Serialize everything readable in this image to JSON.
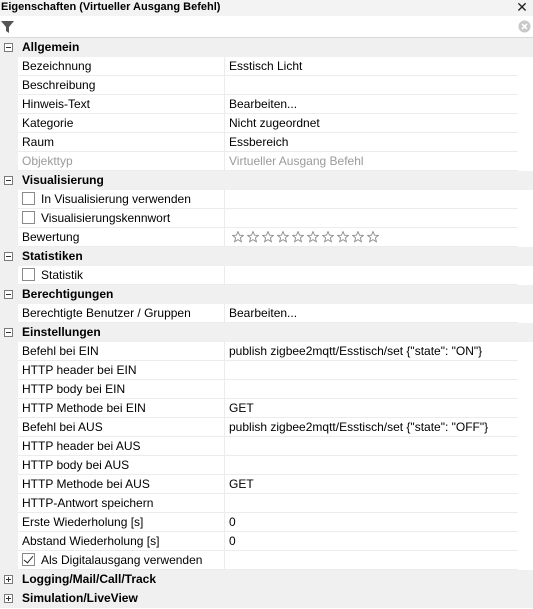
{
  "window": {
    "title": "Eigenschaften (Virtueller Ausgang Befehl)",
    "close_glyph": "✕"
  },
  "filter": {
    "value": "",
    "placeholder": ""
  },
  "categories": {
    "allgemein": {
      "label": "Allgemein",
      "rows": {
        "bezeichnung": {
          "name": "Bezeichnung",
          "value": "Esstisch Licht"
        },
        "beschreibung": {
          "name": "Beschreibung",
          "value": ""
        },
        "hinweis": {
          "name": "Hinweis-Text",
          "value": "Bearbeiten..."
        },
        "kategorie": {
          "name": "Kategorie",
          "value": "Nicht zugeordnet"
        },
        "raum": {
          "name": "Raum",
          "value": "Essbereich"
        },
        "objekttyp": {
          "name": "Objekttyp",
          "value": "Virtueller Ausgang Befehl"
        }
      }
    },
    "visualisierung": {
      "label": "Visualisierung",
      "rows": {
        "in_vis": {
          "name": "In Visualisierung verwenden",
          "checked": false
        },
        "kennwort": {
          "name": "Visualisierungskennwort",
          "checked": false
        },
        "bewertung": {
          "name": "Bewertung",
          "stars_filled": 0,
          "stars_total": 10
        }
      }
    },
    "statistiken": {
      "label": "Statistiken",
      "rows": {
        "statistik": {
          "name": "Statistik",
          "checked": false
        }
      }
    },
    "berechtigungen": {
      "label": "Berechtigungen",
      "rows": {
        "benutzer": {
          "name": "Berechtigte Benutzer / Gruppen",
          "value": "Bearbeiten..."
        }
      }
    },
    "einstellungen": {
      "label": "Einstellungen",
      "rows": {
        "befehl_ein": {
          "name": "Befehl bei EIN",
          "value": "publish zigbee2mqtt/Esstisch/set {\"state\": \"ON\"}"
        },
        "header_ein": {
          "name": "HTTP header bei EIN",
          "value": ""
        },
        "body_ein": {
          "name": "HTTP body bei EIN",
          "value": ""
        },
        "methode_ein": {
          "name": "HTTP Methode bei EIN",
          "value": "GET"
        },
        "befehl_aus": {
          "name": "Befehl bei AUS",
          "value": "publish zigbee2mqtt/Esstisch/set {\"state\": \"OFF\"}"
        },
        "header_aus": {
          "name": "HTTP header bei AUS",
          "value": ""
        },
        "body_aus": {
          "name": "HTTP body bei AUS",
          "value": ""
        },
        "methode_aus": {
          "name": "HTTP Methode bei AUS",
          "value": "GET"
        },
        "antwort": {
          "name": "HTTP-Antwort speichern",
          "value": ""
        },
        "wiederholung": {
          "name": "Erste Wiederholung [s]",
          "value": "0"
        },
        "abstand": {
          "name": "Abstand Wiederholung [s]",
          "value": "0"
        },
        "digital": {
          "name": "Als Digitalausgang verwenden",
          "checked": true
        }
      }
    },
    "logging": {
      "label": "Logging/Mail/Call/Track"
    },
    "simulation": {
      "label": "Simulation/LiveView"
    }
  }
}
